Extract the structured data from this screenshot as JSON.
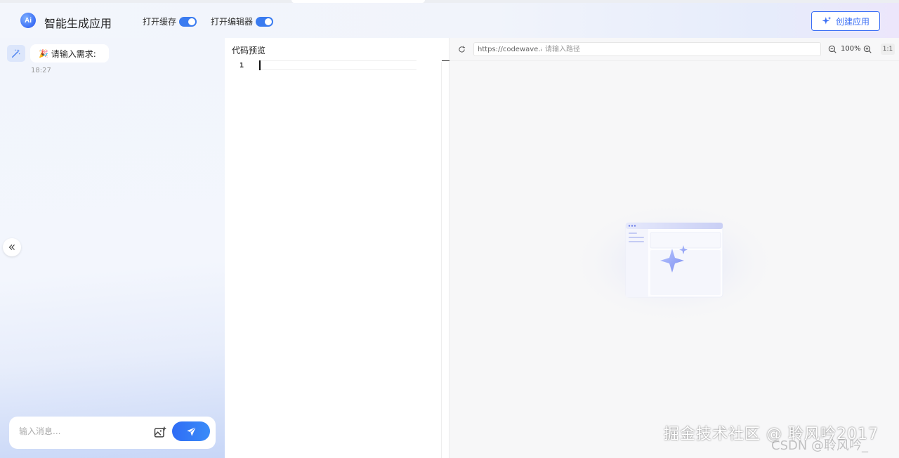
{
  "header": {
    "logo_text": "Ai",
    "title": "智能生成应用",
    "toggles": [
      {
        "label": "打开缓存",
        "on": true
      },
      {
        "label": "打开编辑器",
        "on": true
      }
    ],
    "create_button": "创建应用"
  },
  "chat": {
    "messages": [
      {
        "sender": "ai",
        "emoji": "🎉",
        "text": "请输入需求:",
        "time": "18:27"
      }
    ],
    "input_placeholder": "输入消息..."
  },
  "code_panel": {
    "title": "代码预览",
    "line_numbers": [
      "1"
    ]
  },
  "preview": {
    "url_base": "https://codewave.ai",
    "path_placeholder": "请输入路径",
    "zoom": "100%",
    "ratio": "1:1"
  },
  "watermark": {
    "text": "掘金技术社区 @ 聆风吟2017",
    "faint_text": "CSDN @聆风吟_"
  },
  "colors": {
    "accent": "#3b6ff5",
    "switch_on": "#3a7bf0"
  }
}
